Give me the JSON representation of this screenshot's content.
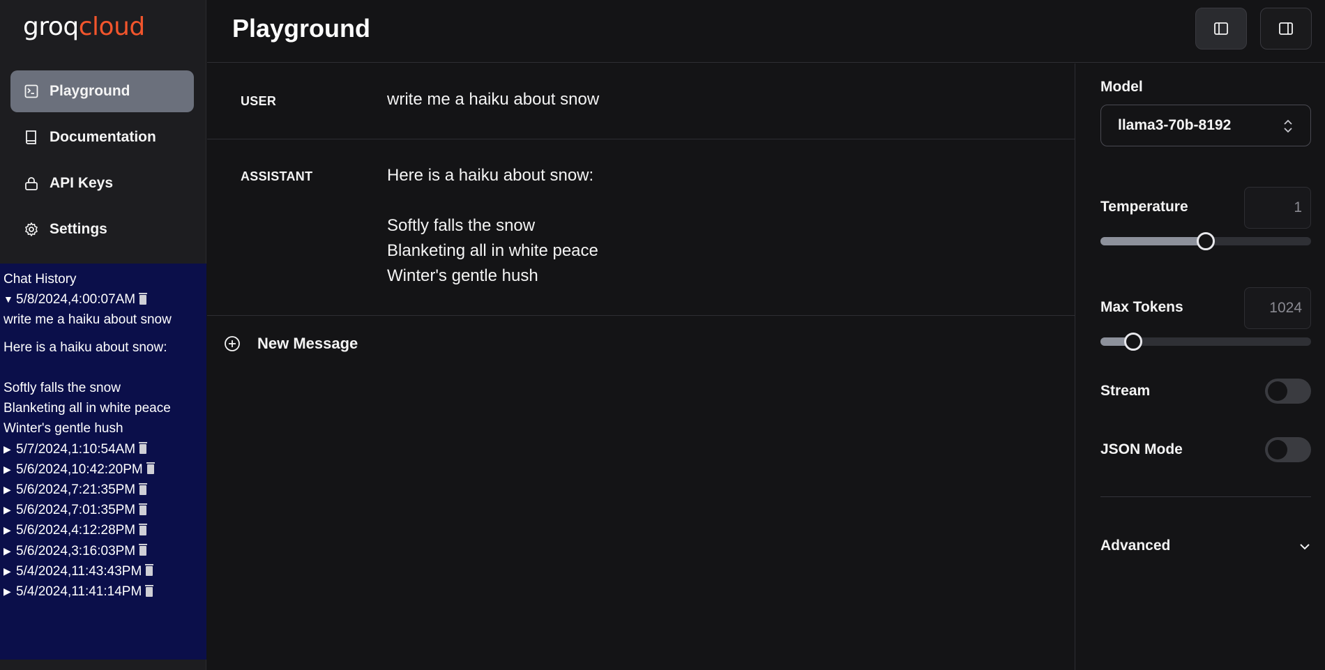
{
  "brand": {
    "logo_primary": "groq",
    "logo_secondary": "cloud",
    "accent_color": "#f2552c"
  },
  "sidebar": {
    "items": [
      {
        "label": "Playground",
        "icon": "terminal-icon",
        "active": true
      },
      {
        "label": "Documentation",
        "icon": "book-icon",
        "active": false
      },
      {
        "label": "API Keys",
        "icon": "lock-icon",
        "active": false
      },
      {
        "label": "Settings",
        "icon": "gear-icon",
        "active": false
      }
    ]
  },
  "history": {
    "title": "Chat History",
    "expanded": {
      "timestamp": "5/8/2024,4:00:07AM",
      "user_message": "write me a haiku about snow",
      "assistant_message": "Here is a haiku about snow:\n\nSoftly falls the snow\nBlanketing all in white peace\nWinter's gentle hush"
    },
    "entries": [
      "5/7/2024,1:10:54AM",
      "5/6/2024,10:42:20PM",
      "5/6/2024,7:21:35PM",
      "5/6/2024,7:01:35PM",
      "5/6/2024,4:12:28PM",
      "5/6/2024,3:16:03PM",
      "5/4/2024,11:43:43PM",
      "5/4/2024,11:41:14PM"
    ]
  },
  "header": {
    "title": "Playground"
  },
  "messages": {
    "user_role": "USER",
    "user_text": "write me a haiku about snow",
    "assistant_role": "ASSISTANT",
    "assistant_text": "Here is a haiku about snow:\n\nSoftly falls the snow\nBlanketing all in white peace\nWinter's gentle hush",
    "new_message_label": "New Message"
  },
  "panel": {
    "model_label": "Model",
    "model_value": "llama3-70b-8192",
    "temperature_label": "Temperature",
    "temperature_value": "1",
    "temperature_fraction": 0.5,
    "max_tokens_label": "Max Tokens",
    "max_tokens_value": "1024",
    "max_tokens_fraction": 0.155,
    "stream_label": "Stream",
    "stream_on": false,
    "json_mode_label": "JSON Mode",
    "json_mode_on": false,
    "advanced_label": "Advanced"
  }
}
